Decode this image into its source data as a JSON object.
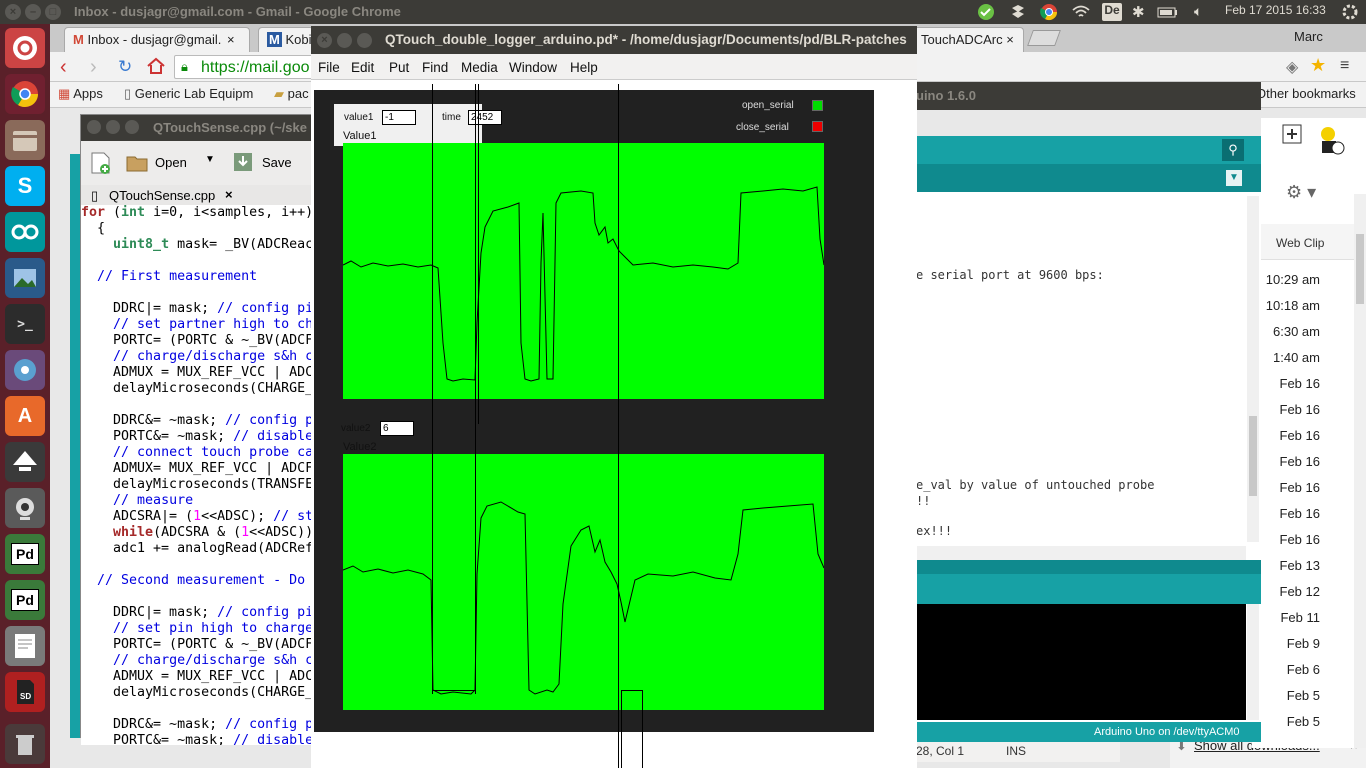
{
  "top_panel": {
    "window_title": "Inbox - dusjagr@gmail.com - Gmail - Google Chrome",
    "datetime": "Feb 17 2015 16:33",
    "user": "Marc",
    "lang": "De"
  },
  "launcher": {
    "items": [
      "Ubuntu Dash",
      "Chromium",
      "Files",
      "Skype",
      "Arduino",
      "Image Viewer",
      "Terminal",
      "Pidgin",
      "Software Center",
      "Inkscape",
      "Camera",
      "Pd",
      "Pd",
      "Text Editor",
      "SD Card",
      "Trash"
    ]
  },
  "chrome": {
    "tabs": [
      "Inbox - dusjagr@gmail.",
      "Kobi",
      "TouchADCArc"
    ],
    "url": "https://mail.goo",
    "bookmarks": [
      "Apps",
      "Generic Lab Equipm",
      "pac"
    ],
    "other_bookmarks": "Other bookmarks",
    "show_downloads": "Show all downloads..."
  },
  "gmail": {
    "web_clip": "Web Clip",
    "times": [
      "10:29 am",
      "10:18 am",
      "6:30 am",
      "1:40 am",
      "Feb 16",
      "Feb 16",
      "Feb 16",
      "Feb 16",
      "Feb 16",
      "Feb 16",
      "Feb 16",
      "Feb 13",
      "Feb 12",
      "Feb 11",
      "Feb 9",
      "Feb 6",
      "Feb 5",
      "Feb 5"
    ]
  },
  "editor": {
    "title": "QTouchSense.cpp (~/ske",
    "open_label": "Open",
    "save_label": "Save",
    "tab_label": "QTouchSense.cpp",
    "lines": [
      "for (int i=0, i<samples, i++)",
      "  {",
      "    uint8_t mask= _BV(ADCReac",
      "",
      "  // First measurement",
      "",
      "    DDRC|= mask; // config pi",
      "    // set partner high to ch",
      "    PORTC= (PORTC & ~_BV(ADCF",
      "    // charge/discharge s&h c",
      "    ADMUX = MUX_REF_VCC | ADC",
      "    delayMicroseconds(CHARGE_",
      "",
      "    DDRC&= ~mask; // config p",
      "    PORTC&= ~mask; // disable",
      "    // connect touch probe ca",
      "    ADMUX= MUX_REF_VCC | ADCF",
      "    delayMicroseconds(TRANSFE",
      "    // measure",
      "    ADCSRA|= (1<<ADSC); // st",
      "    while(ADCSRA & (1<<ADSC))",
      "    adc1 += analogRead(ADCRef",
      "",
      "  // Second measurement - Do",
      "",
      "    DDRC|= mask; // config pi",
      "    // set pin high to charge",
      "    PORTC= (PORTC & ~_BV(ADCF",
      "    // charge/discharge s&h c",
      "    ADMUX = MUX_REF_VCC | ADC",
      "    delayMicroseconds(CHARGE_",
      "",
      "    DDRC&= ~mask; // config p",
      "    PORTC&= ~mask; // disable"
    ]
  },
  "arduino": {
    "title": "uino 1.6.0",
    "text_serial": "e serial port at 9600 bps:",
    "text_val": "e_val by value of untouched probe",
    "text_excl": "!!",
    "text_ex": "ex!!!",
    "status_pos": "28, Col 1",
    "status_ins": "INS",
    "board": "Arduino Uno on /dev/ttyACM0"
  },
  "pd": {
    "title": "QTouch_double_logger_arduino.pd* - /home/dusjagr/Documents/pd/BLR-patches",
    "menu": [
      "File",
      "Edit",
      "Put",
      "Find",
      "Media",
      "Window",
      "Help"
    ],
    "value1_label": "value1",
    "value1": "-1",
    "time_label": "time",
    "time": "2452",
    "plot1_label": "Value1",
    "value2_label": "value2",
    "value2": "6",
    "plot2_label": "Value2",
    "open_serial": "open_serial",
    "close_serial": "close_serial",
    "colors": {
      "plot_bg": "#00ff00",
      "canvas": "#212121",
      "open": "#00dd00",
      "close": "#ee0000"
    }
  }
}
